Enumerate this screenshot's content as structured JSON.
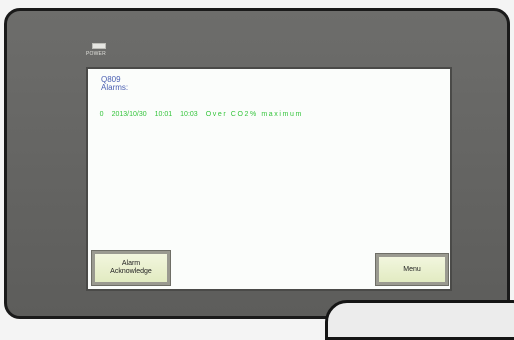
{
  "panel": {
    "power_label": "POWER"
  },
  "screen": {
    "title": "Q809",
    "alarms_label": "Alarms:",
    "alarm": {
      "index": "0",
      "date": "2013/10/30",
      "start_time": "10:01",
      "end_time": "10:03",
      "message": "Over CO2% maximum"
    }
  },
  "buttons": {
    "acknowledge_line1": "Alarm",
    "acknowledge_line2": "Acknowledge",
    "menu": "Menu"
  },
  "colors": {
    "alarm_text": "#33c43a",
    "header_text": "#4a5fb2",
    "button_face": "#e2ebc2",
    "bezel": "#646462"
  },
  "icons": [
    "power-led-icon"
  ]
}
